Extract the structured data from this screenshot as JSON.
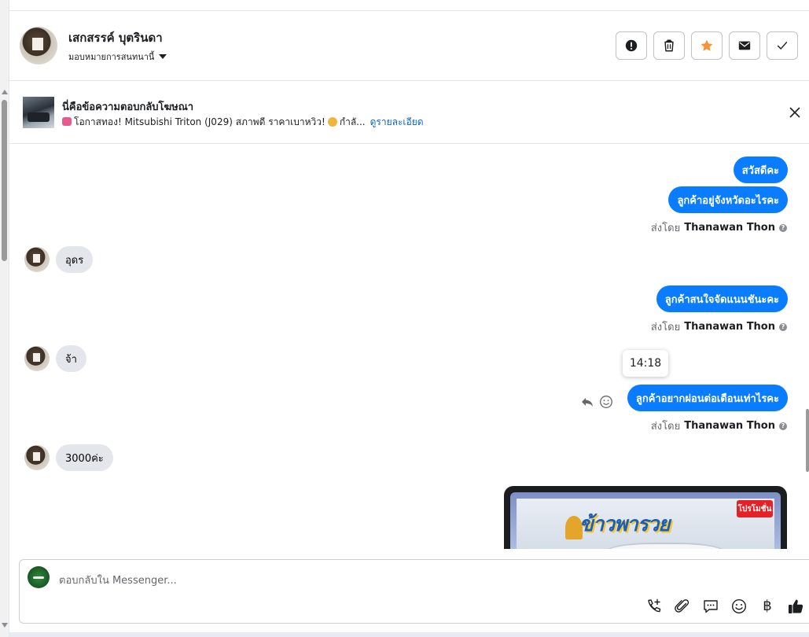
{
  "header": {
    "customer_name": "เสกสรรค์ บุตรินดา",
    "assign_label": "มอบหมายการสนทนานี้",
    "actions": [
      {
        "name": "report-spam-button",
        "icon": "exclamation-icon"
      },
      {
        "name": "delete-button",
        "icon": "trash-icon"
      },
      {
        "name": "star-button",
        "icon": "star-icon"
      },
      {
        "name": "mark-unread-button",
        "icon": "envelope-icon"
      },
      {
        "name": "mark-done-button",
        "icon": "checkmark-icon"
      }
    ],
    "star_color": "#f7923a"
  },
  "ad_banner": {
    "title": "นี่คือข้อความตอบกลับโฆษณา",
    "description_before": "โอกาสทอง! Mitsubishi Triton (J029) สภาพดี ราคาเบาหวิว!",
    "description_after": "กำลั...",
    "details_link": "ดูรายละเอียด"
  },
  "messages": {
    "out_1": "สวัสดีคะ",
    "out_2": "ลูกค้าอยู่จังหวัดอะไรคะ",
    "in_1": "อุดร",
    "out_3": "ลูกค้าสนใจจัดแนนชันะคะ",
    "in_2": "จ้า",
    "out_4": "ลูกค้าอยากผ่อนต่อเดือนเท่าไรคะ",
    "in_3": "3000ค่ะ",
    "sent_by_prefix": "ส่งโดย",
    "sent_by_name": "Thanawan Thon",
    "tooltip_time": "14:18",
    "accent": "#0a7cff"
  },
  "image_card": {
    "promo_badge": "โปรโมชั่น",
    "headline": "ข้าวพารวย"
  },
  "composer": {
    "placeholder": "ตอบกลับใน Messenger...",
    "currency_symbol": "฿"
  }
}
